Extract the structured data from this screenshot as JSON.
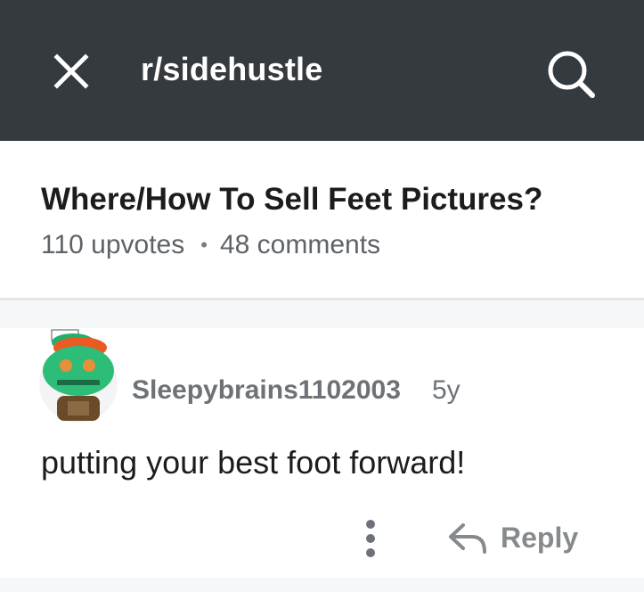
{
  "header": {
    "subreddit": "r/sidehustle",
    "close_icon": "close-icon",
    "search_icon": "search-icon",
    "background_color": "#353a3e"
  },
  "post": {
    "title": "Where/How To Sell Feet Pictures?",
    "upvotes": "110 upvotes",
    "separator": "•",
    "comments": "48 comments"
  },
  "comment": {
    "author": "Sleepybrains1102003",
    "age": "5y",
    "body": "putting your best foot forward!",
    "avatar_icon": "snoo-avatar",
    "more_icon": "more-options-icon",
    "reply_icon": "reply-arrow-icon",
    "reply_label": "Reply"
  }
}
